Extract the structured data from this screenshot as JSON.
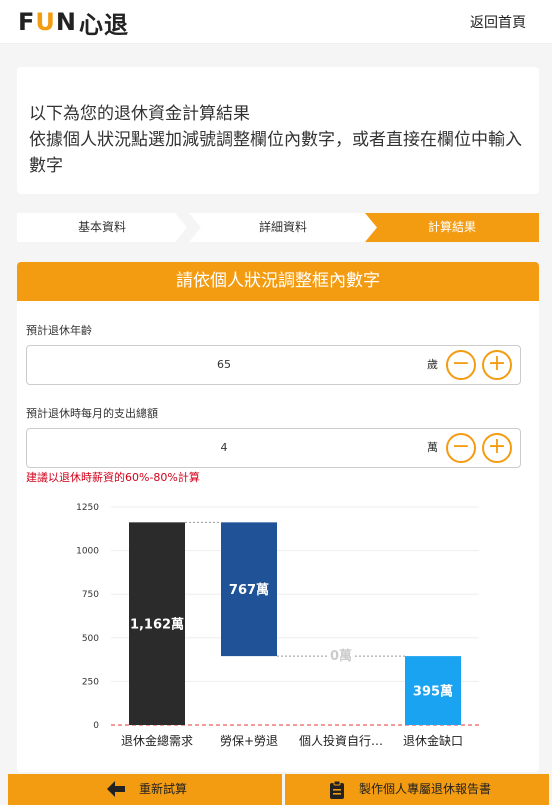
{
  "header": {
    "logo_f": "F",
    "logo_u": "U",
    "logo_n": "N",
    "logo_zh": "心退",
    "home_link": "返回首頁"
  },
  "intro": {
    "line1": "以下為您的退休資金計算結果",
    "line2": "依據個人狀況點選加減號調整欄位內數字，或者直接在欄位中輸入數字"
  },
  "steps": [
    "基本資料",
    "詳細資料",
    "計算結果"
  ],
  "card": {
    "title": "請依個人狀況調整框內數字",
    "fields": [
      {
        "label": "預計退休年齡",
        "value": "65",
        "unit": "歲",
        "minus": "−",
        "plus": "+"
      },
      {
        "label": "預計退休時每月的支出總額",
        "value": "4",
        "unit": "萬",
        "minus": "−",
        "plus": "+"
      }
    ],
    "hint": "建議以退休時薪資的60%-80%計算"
  },
  "chart_data": {
    "type": "bar",
    "subtype": "waterfall",
    "categories": [
      "退休金總需求",
      "勞保+勞退",
      "個人投資自行…",
      "退休金缺口"
    ],
    "values": [
      1162,
      767,
      0,
      395
    ],
    "base": [
      0,
      395,
      395,
      0
    ],
    "data_labels": [
      "1,162萬",
      "767萬",
      "0萬",
      "395萬"
    ],
    "colors": [
      "#2b2b2b",
      "#1f5296",
      "#cccccc",
      "#1aa3f0"
    ],
    "ylim": [
      0,
      1250
    ],
    "yticks": [
      0,
      250,
      500,
      750,
      1000,
      1250
    ],
    "grid": true
  },
  "footer": {
    "left_label": "重新試算",
    "right_label": "製作個人專屬退休報告書"
  }
}
